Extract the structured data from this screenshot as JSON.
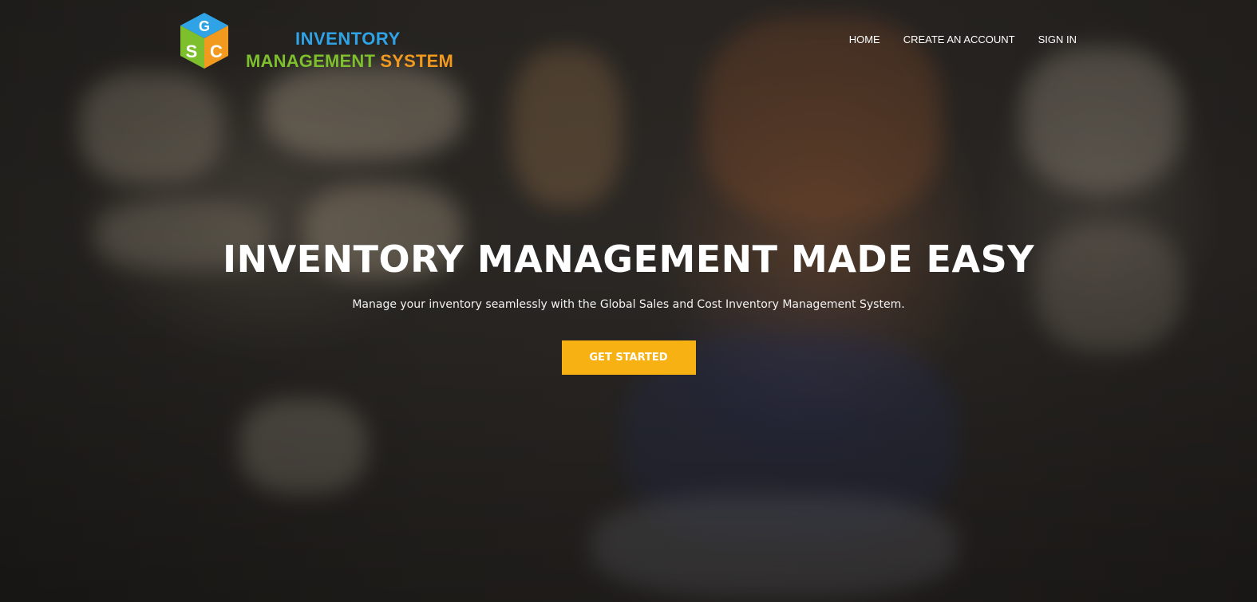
{
  "brand": {
    "line1": "INVENTORY",
    "line2_word1": "MANAGEMENT",
    "line2_word2": "SYSTEM",
    "logo_letters": [
      "G",
      "S",
      "C"
    ],
    "colors": {
      "blue": "#2fa3e6",
      "green": "#7dbf2d",
      "orange": "#f29a1f"
    }
  },
  "nav": {
    "items": [
      {
        "label": "HOME"
      },
      {
        "label": "CREATE AN ACCOUNT"
      },
      {
        "label": "SIGN IN"
      }
    ]
  },
  "hero": {
    "title": "INVENTORY MANAGEMENT MADE EASY",
    "subtitle": "Manage your inventory seamlessly with the Global Sales and Cost Inventory Management System.",
    "cta_label": "GET STARTED",
    "cta_color": "#f7b112"
  }
}
